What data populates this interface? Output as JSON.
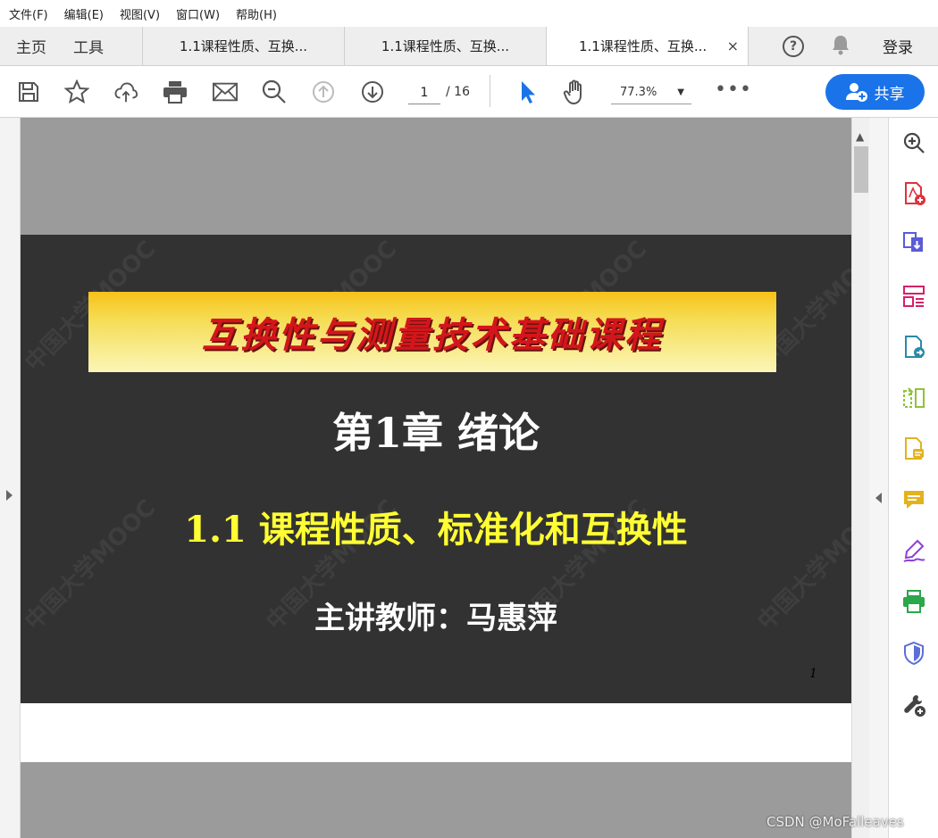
{
  "menu": {
    "file": "文件(F)",
    "edit": "编辑(E)",
    "view": "视图(V)",
    "window": "窗口(W)",
    "help": "帮助(H)"
  },
  "tabs": {
    "home": "主页",
    "tools": "工具",
    "docs": [
      {
        "label": "1.1课程性质、互换..."
      },
      {
        "label": "1.1课程性质、互换..."
      },
      {
        "label": "1.1课程性质、互换..."
      }
    ],
    "close_glyph": "×",
    "help_glyph": "?",
    "login": "登录"
  },
  "toolbar": {
    "current_page": "1",
    "total_pages": "/ 16",
    "zoom": "77.3%",
    "more": "•••",
    "share_label": "共享",
    "accent": "#1a73e8"
  },
  "slide": {
    "banner_title": "互换性与测量技术基础课程",
    "chapter": "第1章 绪论",
    "section": "1.1 课程性质、标准化和互换性",
    "teacher": "主讲教师：马惠萍",
    "page_marker": "1",
    "watermark": "中国大学MOOC"
  },
  "right_tools": [
    "zoom-tool-icon",
    "create-pdf-icon",
    "export-pdf-icon",
    "organize-pages-icon",
    "convert-pdf-icon",
    "compare-icon",
    "edit-pdf-icon",
    "comment-icon",
    "fill-sign-icon",
    "print-production-icon",
    "protect-icon",
    "more-tools-icon"
  ],
  "credit": "CSDN @MoFalleaves"
}
